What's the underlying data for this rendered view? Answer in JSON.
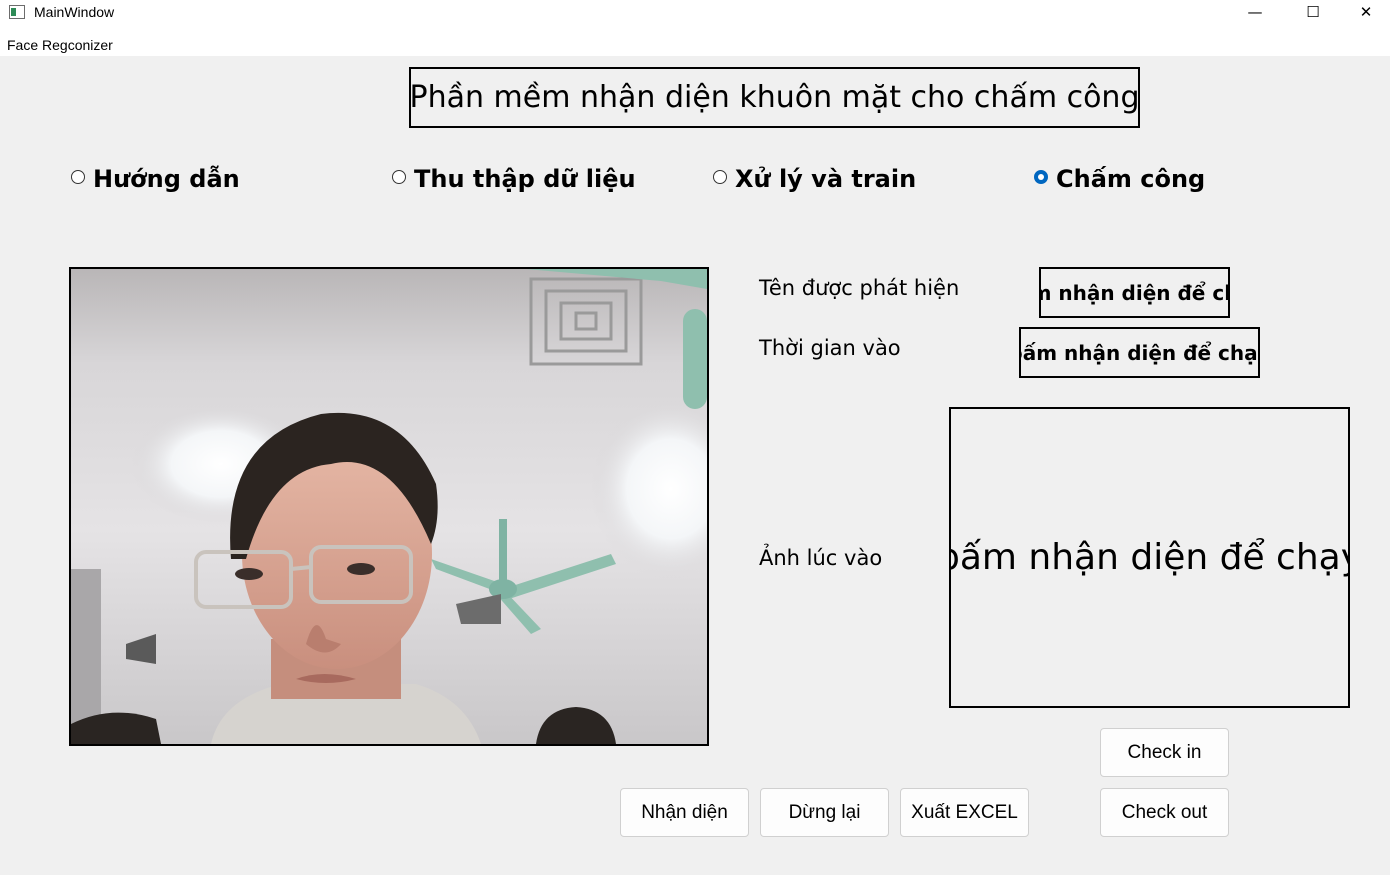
{
  "window": {
    "title": "MainWindow",
    "minimize_glyph": "—",
    "maximize_glyph": "☐",
    "close_glyph": "✕"
  },
  "menu": {
    "items": [
      {
        "label": "Face Regconizer"
      }
    ]
  },
  "header": {
    "title": "Phần mềm nhận diện khuôn mặt cho chấm công"
  },
  "mode_radios": [
    {
      "label": "Hướng dẫn",
      "checked": false
    },
    {
      "label": "Thu thập dữ liệu",
      "checked": false
    },
    {
      "label": "Xử lý và train",
      "checked": false
    },
    {
      "label": "Chấm công",
      "checked": true
    }
  ],
  "info": {
    "name_label": "Tên được phát hiện",
    "name_value": "m nhận diện để ch",
    "time_label": "Thời gian vào",
    "time_value": "bấm nhận diện để chạy",
    "photo_label": "Ảnh lúc vào",
    "photo_value": "bấm nhận diện để chạy"
  },
  "buttons": {
    "recognize": "Nhận diện",
    "stop": "Dừng lại",
    "export": "Xuất EXCEL",
    "check_in": "Check in",
    "check_out": "Check out"
  },
  "colors": {
    "accent": "#0067c0",
    "background": "#f0f0f0"
  }
}
